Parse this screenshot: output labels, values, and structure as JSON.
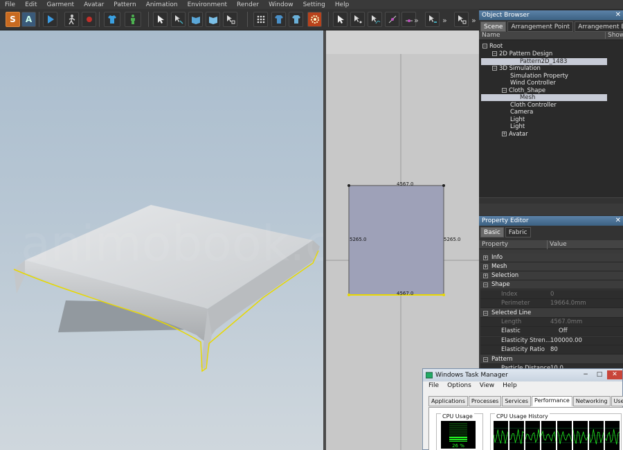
{
  "menu": [
    "File",
    "Edit",
    "Garment",
    "Avatar",
    "Pattern",
    "Animation",
    "Environment",
    "Render",
    "Window",
    "Setting",
    "Help"
  ],
  "toolbar": {
    "s_label": "S",
    "a_label": "A",
    "overflow": "»"
  },
  "pattern2d": {
    "top_label": "4567.0",
    "bottom_label": "4567.0",
    "left_label": "5265.0",
    "right_label": "5265.0"
  },
  "object_browser": {
    "title": "Object Browser",
    "close": "✕",
    "tabs": [
      "Scene",
      "Arrangement Point",
      "Arrangement BV"
    ],
    "col_name": "Name",
    "col_show": "Show",
    "tree": {
      "root": "Root",
      "pattern_design": "2D Pattern Design",
      "pattern2d": "Pattern2D_1483",
      "simulation": "3D Simulation",
      "sim_prop": "Simulation Property",
      "wind": "Wind Controller",
      "cloth_shape": "Cloth_Shape",
      "mesh": "Mesh",
      "cloth_ctrl": "Cloth Controller",
      "camera": "Camera",
      "light1": "Light",
      "light2": "Light",
      "avatar": "Avatar"
    }
  },
  "property_editor": {
    "title": "Property Editor",
    "close": "✕",
    "tabs": [
      "Basic",
      "Fabric"
    ],
    "col_property": "Property",
    "col_value": "Value",
    "rows": {
      "info": "Info",
      "mesh": "Mesh",
      "selection": "Selection",
      "shape": "Shape",
      "index_k": "Index",
      "index_v": "0",
      "perim_k": "Perimeter",
      "perim_v": "19664.0mm",
      "selected_line": "Selected Line",
      "length_k": "Length",
      "length_v": "4567.0mm",
      "elastic_k": "Elastic",
      "elastic_v": "Off",
      "estr_k": "Elasticity Stren...",
      "estr_v": "100000.00",
      "erat_k": "Elasticity Ratio",
      "erat_v": "80",
      "pattern": "Pattern",
      "pdist_k": "Particle Distance",
      "pdist_v": "10.0"
    }
  },
  "task_manager": {
    "title": "Windows Task Manager",
    "menu": [
      "File",
      "Options",
      "View",
      "Help"
    ],
    "tabs": [
      "Applications",
      "Processes",
      "Services",
      "Performance",
      "Networking",
      "Users"
    ],
    "cpu_usage_label": "CPU Usage",
    "cpu_history_label": "CPU Usage History",
    "cpu_percent": "26 %",
    "cpu_value": 26
  }
}
